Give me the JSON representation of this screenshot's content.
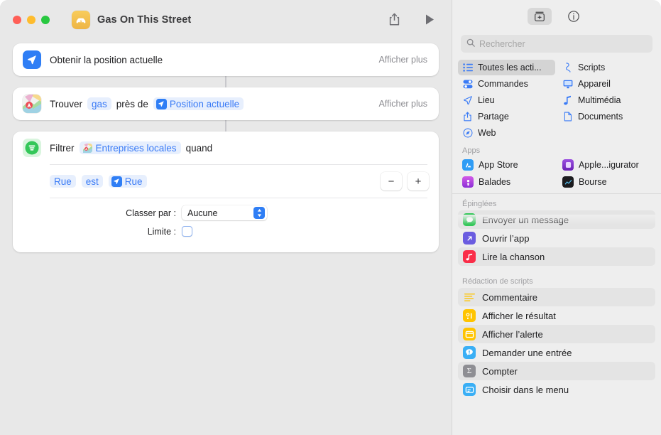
{
  "window": {
    "title": "Gas On This Street",
    "app_icon": "shortcut-app-icon",
    "share_label": "Partager",
    "run_label": "Exécuter"
  },
  "colors": {
    "accent_blue": "#3a7bf6",
    "token_bg": "#e7effd",
    "location_blue": "#2f7ef5",
    "filter_green": "#34c759",
    "app_icon_yellow": "#f1bc4b",
    "window_bg": "#e8e8e8",
    "sidebar_bg": "#eeeeee"
  },
  "editor": {
    "actions": [
      {
        "id": "get-current-location",
        "icon": "location-arrow-icon",
        "title": "Obtenir la position actuelle",
        "show_more": "Afficher plus"
      },
      {
        "id": "find-nearby",
        "icon": "maps-icon",
        "prefix": "Trouver",
        "query_token": "gas",
        "middle": "près de",
        "variable_token": "Position actuelle",
        "variable_icon": "location-arrow-icon",
        "show_more": "Afficher plus"
      }
    ],
    "filter_action": {
      "id": "filter-local-businesses",
      "icon": "filter-lines-icon",
      "prefix": "Filtrer",
      "subject_token": "Entreprises locales",
      "subject_icon": "maps-small-icon",
      "suffix": "quand",
      "condition": {
        "field": "Rue",
        "operator": "est",
        "value": "Rue",
        "value_icon": "location-arrow-icon",
        "remove_label": "−",
        "add_label": "+"
      },
      "sort_label": "Classer par :",
      "sort_value": "Aucune",
      "limit_label": "Limite :",
      "limit_checked": false
    }
  },
  "sidebar": {
    "toolbar": [
      {
        "id": "library",
        "icon": "action-library-icon",
        "active": true
      },
      {
        "id": "info",
        "icon": "info-circle-icon",
        "active": false
      }
    ],
    "search": {
      "placeholder": "Rechercher",
      "value": "",
      "icon": "search-icon"
    },
    "categories": [
      {
        "label": "Toutes les acti...",
        "icon": "list-bullet-icon",
        "selected": true
      },
      {
        "label": "Scripts",
        "icon": "scripts-icon",
        "selected": false
      },
      {
        "label": "Commandes",
        "icon": "controls-icon",
        "selected": false
      },
      {
        "label": "Appareil",
        "icon": "display-icon",
        "selected": false
      },
      {
        "label": "Lieu",
        "icon": "location-arrow-icon",
        "selected": false
      },
      {
        "label": "Multimédia",
        "icon": "music-note-icon",
        "selected": false
      },
      {
        "label": "Partage",
        "icon": "share-icon",
        "selected": false
      },
      {
        "label": "Documents",
        "icon": "document-icon",
        "selected": false
      },
      {
        "label": "Web",
        "icon": "safari-compass-icon",
        "selected": false
      }
    ],
    "apps_header": "Apps",
    "apps": [
      {
        "label": "App Store",
        "icon": "app-store-icon",
        "color": "#2f9cf5"
      },
      {
        "label": "Apple...igurator",
        "icon": "apple-configurator-icon",
        "color": "#7b2fd6"
      },
      {
        "label": "Balades",
        "icon": "podcasts-icon",
        "color": "#9b3bd6"
      },
      {
        "label": "Bourse",
        "icon": "stocks-icon",
        "color": "#1c1c1e"
      }
    ],
    "pinned_header": "Épinglées",
    "pinned": [
      {
        "label": "Envoyer un message",
        "icon": "message-bubble-icon",
        "color": "#34c759",
        "alt": true
      },
      {
        "label": "Ouvrir l’app",
        "icon": "open-app-icon",
        "color": "#6a5ce0",
        "alt": false
      },
      {
        "label": "Lire la chanson",
        "icon": "music-note-icon",
        "color": "#fa2d48",
        "alt": true
      }
    ],
    "scripting_header": "Rédaction de scripts",
    "scripting": [
      {
        "label": "Commentaire",
        "icon": "comment-lines-icon",
        "color": "#ffffff",
        "alt": true
      },
      {
        "label": "Afficher le résultat",
        "icon": "show-result-icon",
        "color": "#ffc400",
        "alt": false
      },
      {
        "label": "Afficher l’alerte",
        "icon": "show-alert-icon",
        "color": "#ffc400",
        "alt": true
      },
      {
        "label": "Demander une entrée",
        "icon": "ask-input-icon",
        "color": "#3aaff5",
        "alt": false
      },
      {
        "label": "Compter",
        "icon": "sigma-count-icon",
        "color": "#8e8e93",
        "alt": true
      },
      {
        "label": "Choisir dans le menu",
        "icon": "choose-menu-icon",
        "color": "#3aaff5",
        "alt": false
      }
    ]
  }
}
